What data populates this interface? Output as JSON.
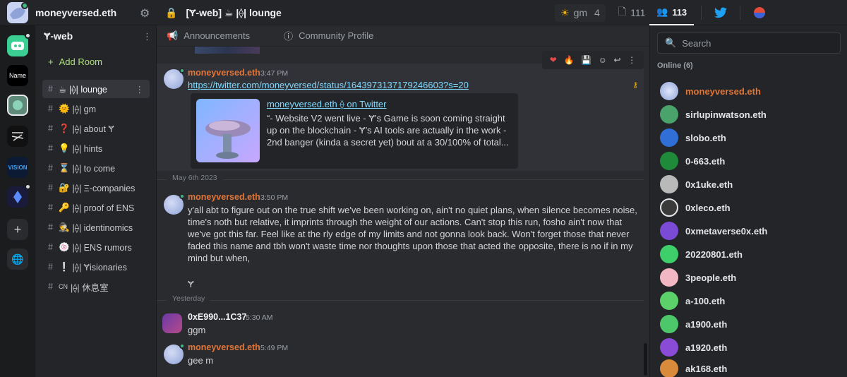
{
  "topbar": {
    "username": "moneyversed.eth",
    "room_title": "[Ɏ-web] ☕ |⟠| lounge",
    "gm_label": "gm",
    "gm_count": "4",
    "page_count": "111",
    "member_count": "113"
  },
  "space": {
    "title": "Ɏ-web",
    "add_room": "Add Room"
  },
  "rooms": [
    {
      "emoji": "☕",
      "label": "|⟠| lounge",
      "active": true
    },
    {
      "emoji": "🌞",
      "label": "|⟠| gm"
    },
    {
      "emoji": "❓",
      "label": "|⟠| about Ɏ"
    },
    {
      "emoji": "💡",
      "label": "|⟠| hints"
    },
    {
      "emoji": "⌛",
      "label": "|⟠| to come"
    },
    {
      "emoji": "🔐",
      "label": "|⟠| Ξ-companies"
    },
    {
      "emoji": "🔑",
      "label": "|⟠| proof of ENS"
    },
    {
      "emoji": "🕵",
      "label": "|⟠| identinomics"
    },
    {
      "emoji": "🍥",
      "label": "|⟠| ENS rumors"
    },
    {
      "emoji": "❕",
      "label": "|⟠| Ɏisionaries"
    },
    {
      "emoji": "CN",
      "label": "|⟠| 休息室"
    }
  ],
  "pinned": {
    "announcements": "Announcements",
    "community": "Community Profile"
  },
  "messages": {
    "m1": {
      "author": "moneyversed.eth",
      "time": "3:47 PM",
      "link": "https://twitter.com/moneyversed/status/1643973137179246603?s=20",
      "embed_title": "moneyversed.eth ⟠ on Twitter",
      "embed_desc": "“- Website V2 went live - Ɏ’s Game is soon coming straight up on the blockchain - Ɏ’s AI tools are actually in the work - 2nd banger (kinda a secret yet) bout at a 30/100% of total..."
    },
    "date1": "May 6th 2023",
    "m2": {
      "author": "moneyversed.eth",
      "time": "3:50 PM",
      "text": "y'all abt to figure out on the true shift we've been working on, ain't no quiet plans, when silence becomes noise, time's noth but relative, it imprints through the weight of our actions. Can't stop this run, fosho ain't now that we've got this far. Feel like at the rly edge of my limits and not gonna look back. Won't forget those that never faded this name and tbh won't waste time nor thoughts upon those that acted the opposite, there is no if in my mind but when,",
      "sig": "Ɏ"
    },
    "date2": "Yesterday",
    "m3": {
      "author": "0xE990...1C37",
      "time": "5:30 AM",
      "text": "ggm"
    },
    "m4": {
      "author": "moneyversed.eth",
      "time": "5:49 PM",
      "text": "gee m"
    }
  },
  "member_panel": {
    "search_placeholder": "Search",
    "online_heading": "Online (6)",
    "members": [
      {
        "name": "moneyversed.eth",
        "color": "#8fa3d8"
      },
      {
        "name": "sirlupinwatson.eth",
        "color": "#4aa36a"
      },
      {
        "name": "slobo.eth",
        "color": "#2f6fd6"
      },
      {
        "name": "0-663.eth",
        "color": "#1f8a3a"
      },
      {
        "name": "0x1uke.eth",
        "color": "#b9b9b9"
      },
      {
        "name": "0xleco.eth",
        "color": "#3a3a3a"
      },
      {
        "name": "0xmetaverse0x.eth",
        "color": "#7b4bd6"
      },
      {
        "name": "20220801.eth",
        "color": "#3fcf6a"
      },
      {
        "name": "3people.eth",
        "color": "#f3b7c4"
      },
      {
        "name": "a-100.eth",
        "color": "#5cd16a"
      },
      {
        "name": "a1900.eth",
        "color": "#4cc86a"
      },
      {
        "name": "a1920.eth",
        "color": "#8a4cd6"
      },
      {
        "name": "ak168.eth",
        "color": "#d98a3a"
      }
    ]
  }
}
